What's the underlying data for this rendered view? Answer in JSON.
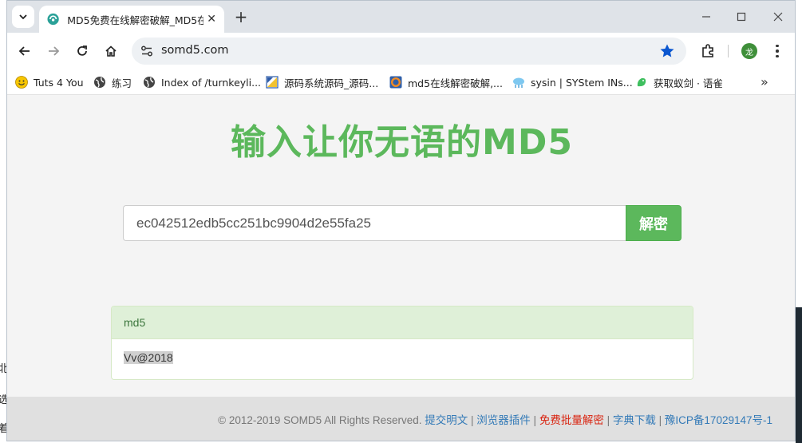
{
  "browser": {
    "tab": {
      "title": "MD5免费在线解密破解_MD5在"
    },
    "url": "somd5.com",
    "avatar_letter": "龙",
    "bookmarks": [
      {
        "label": "Tuts 4 You",
        "icon": "smiley-icon"
      },
      {
        "label": "练习",
        "icon": "globe-icon"
      },
      {
        "label": "Index of /turnkeyli...",
        "icon": "globe-icon"
      },
      {
        "label": "源码系统源码_源码...",
        "icon": "source-site-icon"
      },
      {
        "label": "md5在线解密破解,...",
        "icon": "cmd5-icon"
      },
      {
        "label": "sysin | SYStem INs...",
        "icon": "sysin-icon"
      },
      {
        "label": "获取蚁剑 · 语雀",
        "icon": "yuque-icon"
      }
    ]
  },
  "desktop_chars": [
    "北",
    "选",
    "着"
  ],
  "page": {
    "headline": "输入让你无语的MD5",
    "search": {
      "value": "ec042512edb5cc251bc9904d2e55fa25",
      "button": "解密"
    },
    "result": {
      "label": "md5",
      "value": "Vv@2018"
    },
    "footer": {
      "copyright": "© 2012-2019 SOMD5 All Rights Reserved.",
      "sep": "|",
      "links": [
        "提交明文",
        "浏览器插件",
        "免费批量解密",
        "字典下载",
        "豫ICP备17029147号-1"
      ]
    }
  },
  "colors": {
    "accent": "#5cb85c",
    "panel_head": "#dff0d8",
    "link": "#337ab7",
    "red_link": "#d9230f"
  }
}
